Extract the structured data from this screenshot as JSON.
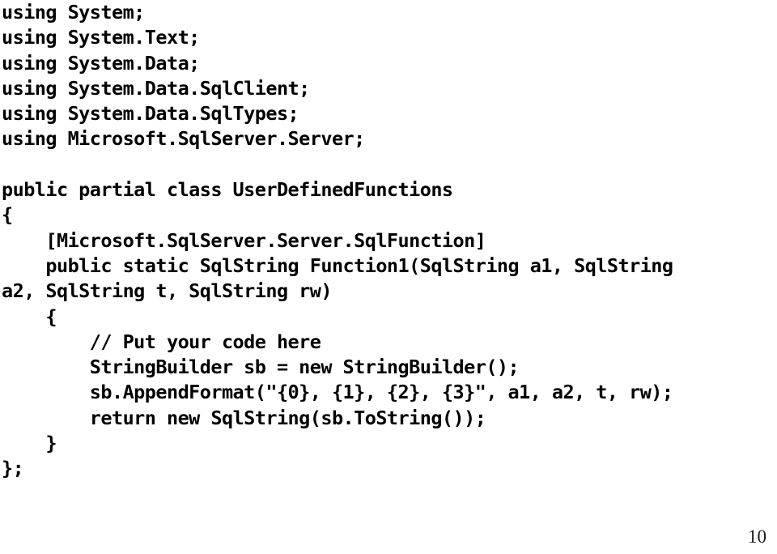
{
  "slide": {
    "background_color": "#ffffff",
    "text_color": "#000000",
    "page_number": "10",
    "code_lines": [
      "using System;",
      "using System.Text;",
      "using System.Data;",
      "using System.Data.SqlClient;",
      "using System.Data.SqlTypes;",
      "using Microsoft.SqlServer.Server;",
      "",
      "public partial class UserDefinedFunctions",
      "{",
      "    [Microsoft.SqlServer.Server.SqlFunction]",
      "    public static SqlString Function1(SqlString a1, SqlString",
      "a2, SqlString t, SqlString rw)",
      "    {",
      "        // Put your code here",
      "        StringBuilder sb = new StringBuilder();",
      "        sb.AppendFormat(\"{0}, {1}, {2}, {3}\", a1, a2, t, rw);",
      "        return new SqlString(sb.ToString());",
      "    }",
      "};"
    ]
  }
}
